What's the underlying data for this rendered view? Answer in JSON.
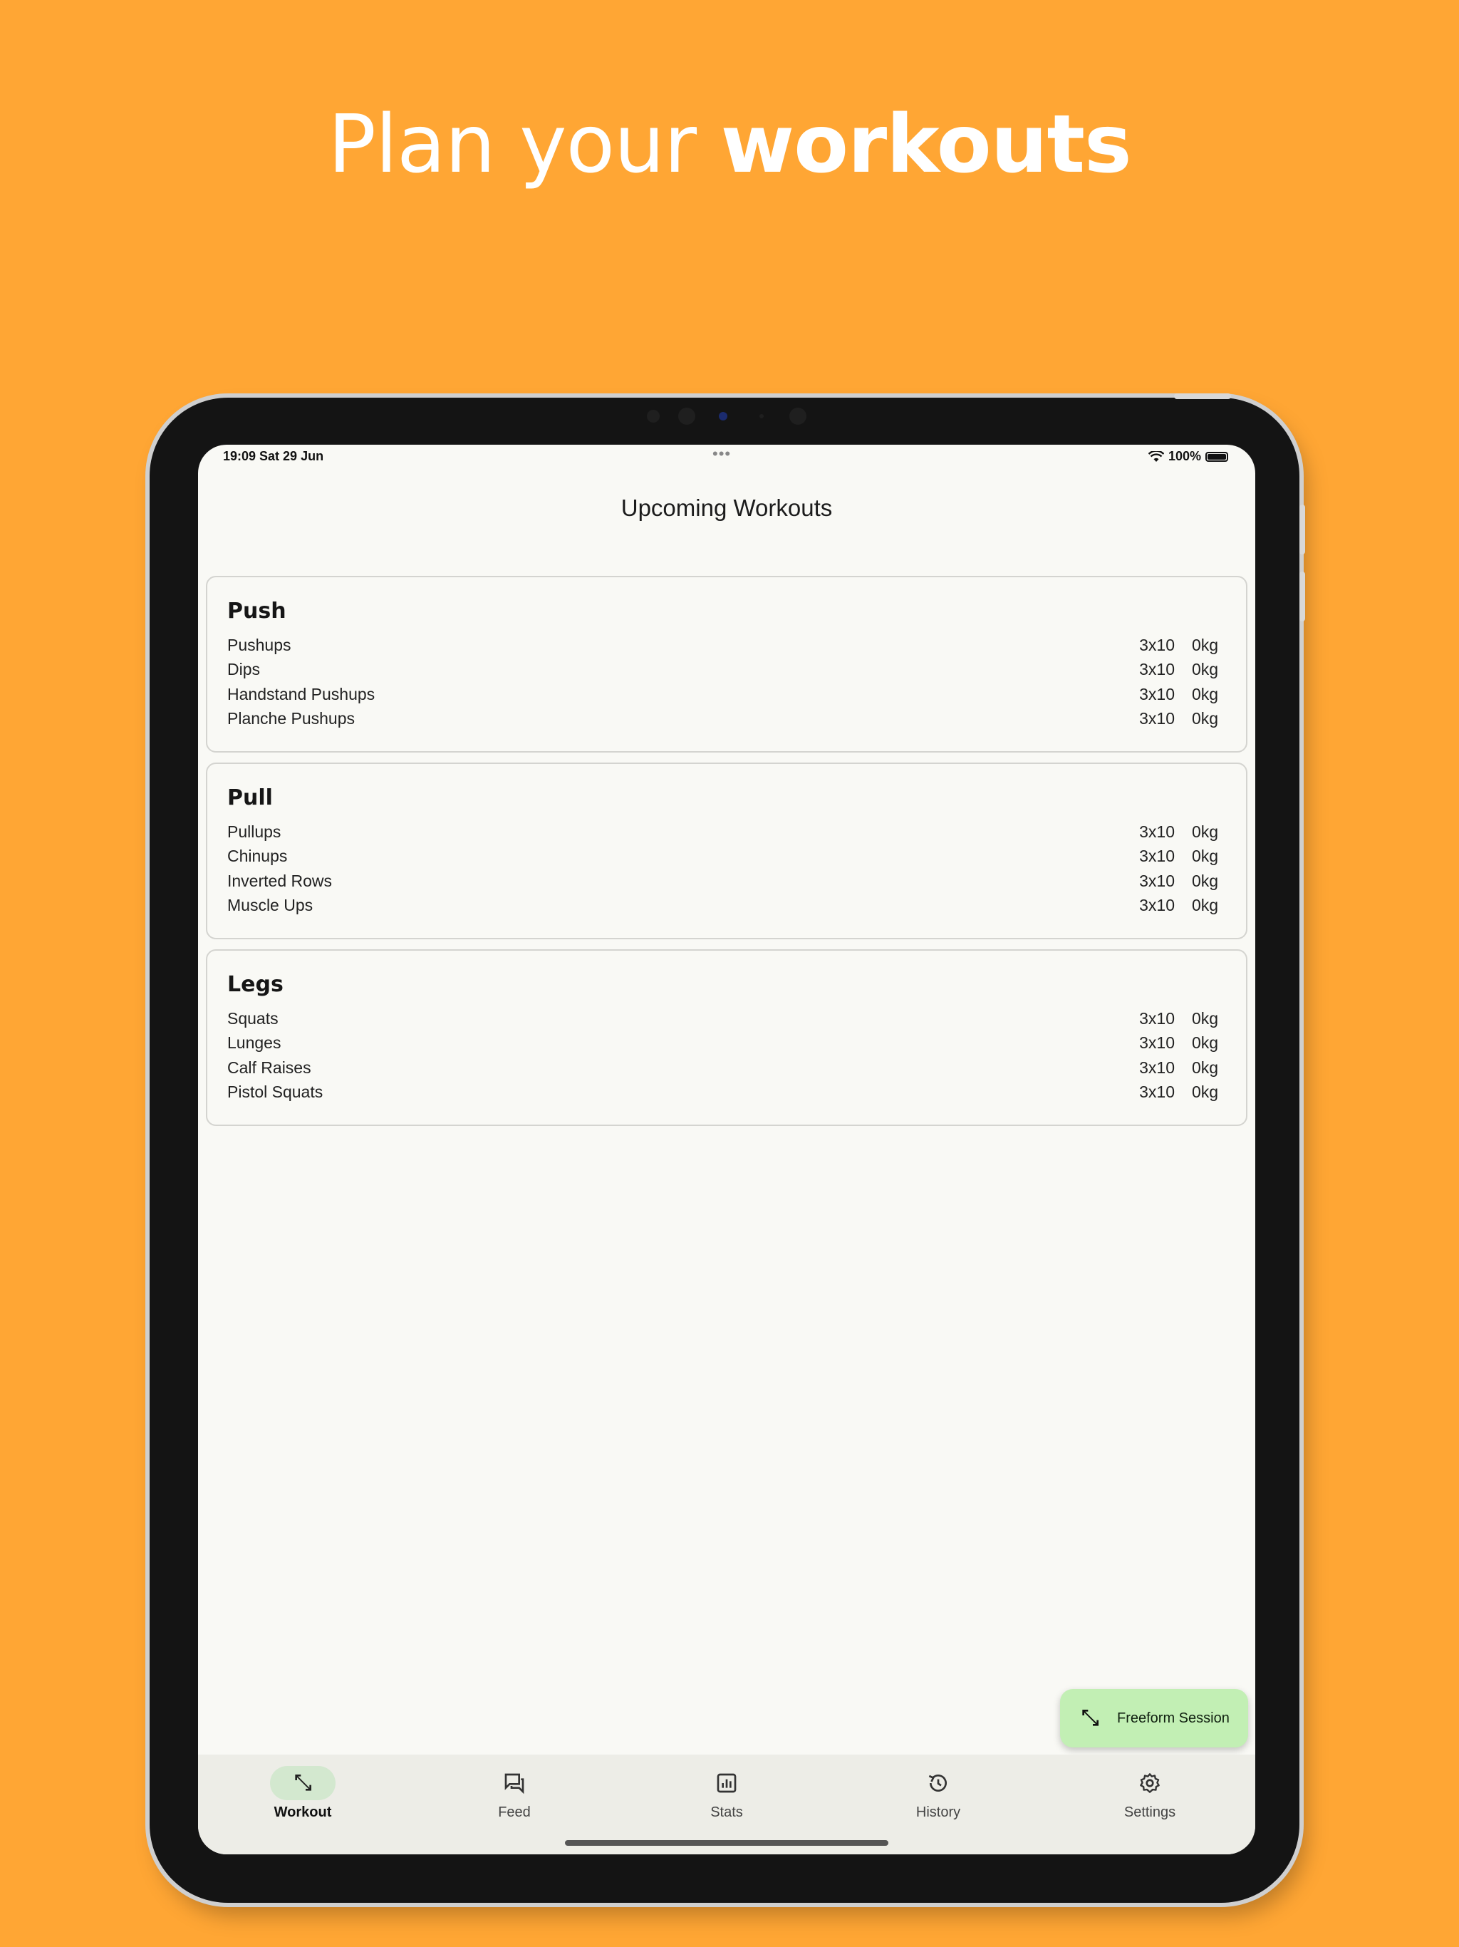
{
  "headline": {
    "light": "Plan your ",
    "bold": "workouts"
  },
  "status_bar": {
    "time": "19:09  Sat 29 Jun",
    "dots": "•••",
    "battery_pct": "100%"
  },
  "screen_title": "Upcoming Workouts",
  "workouts": [
    {
      "name": "Push",
      "exercises": [
        {
          "name": "Pushups",
          "sets": "3x10",
          "weight": "0kg"
        },
        {
          "name": "Dips",
          "sets": "3x10",
          "weight": "0kg"
        },
        {
          "name": "Handstand Pushups",
          "sets": "3x10",
          "weight": "0kg"
        },
        {
          "name": "Planche Pushups",
          "sets": "3x10",
          "weight": "0kg"
        }
      ]
    },
    {
      "name": "Pull",
      "exercises": [
        {
          "name": "Pullups",
          "sets": "3x10",
          "weight": "0kg"
        },
        {
          "name": "Chinups",
          "sets": "3x10",
          "weight": "0kg"
        },
        {
          "name": "Inverted Rows",
          "sets": "3x10",
          "weight": "0kg"
        },
        {
          "name": "Muscle Ups",
          "sets": "3x10",
          "weight": "0kg"
        }
      ]
    },
    {
      "name": "Legs",
      "exercises": [
        {
          "name": "Squats",
          "sets": "3x10",
          "weight": "0kg"
        },
        {
          "name": "Lunges",
          "sets": "3x10",
          "weight": "0kg"
        },
        {
          "name": "Calf Raises",
          "sets": "3x10",
          "weight": "0kg"
        },
        {
          "name": "Pistol Squats",
          "sets": "3x10",
          "weight": "0kg"
        }
      ]
    }
  ],
  "fab": {
    "label": "Freeform Session",
    "icon": "dumbbell-icon"
  },
  "nav": [
    {
      "label": "Workout",
      "icon": "dumbbell-icon",
      "active": true
    },
    {
      "label": "Feed",
      "icon": "chat-icon",
      "active": false
    },
    {
      "label": "Stats",
      "icon": "bar-chart-icon",
      "active": false
    },
    {
      "label": "History",
      "icon": "history-icon",
      "active": false
    },
    {
      "label": "Settings",
      "icon": "gear-icon",
      "active": false
    }
  ],
  "colors": {
    "background": "#FFA634",
    "fab": "#C2EFB4",
    "nav_active": "#D3E8CF",
    "screen": "#F9F9F5"
  }
}
